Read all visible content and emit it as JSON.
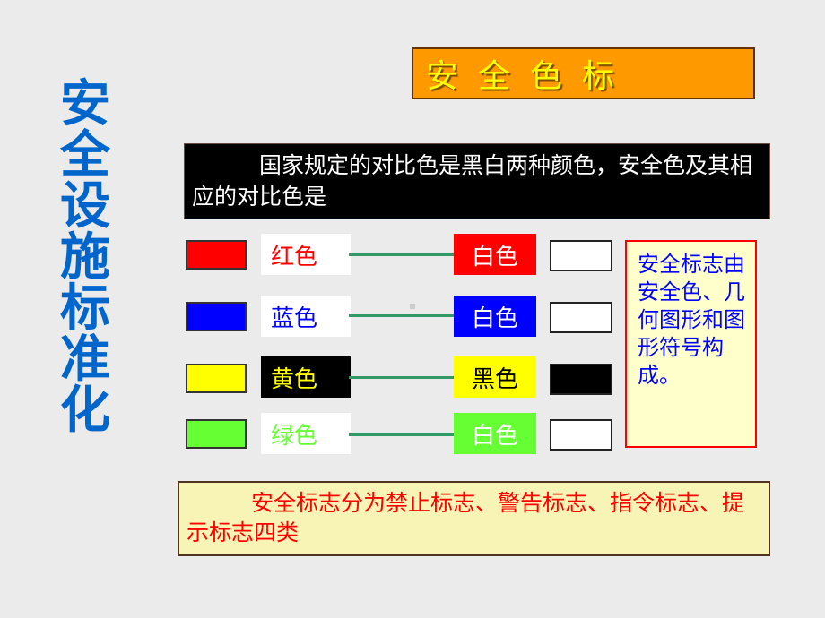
{
  "side_title": [
    "安",
    "全",
    "设",
    "施",
    "标",
    "准",
    "化"
  ],
  "title": "安全色标",
  "intro_text": "国家规定的对比色是黑白两种颜色，安全色及其相应的对比色是",
  "rows": [
    {
      "color_name": "红色",
      "swatch_color": "#ff0000",
      "label_bg": "#ffffff",
      "label_fg": "#ff0000",
      "contrast_name": "白色",
      "contrast_label_bg": "#ff0000",
      "contrast_label_fg": "#ffffff",
      "contrast_swatch_color": "#ffffff"
    },
    {
      "color_name": "蓝色",
      "swatch_color": "#0000ff",
      "label_bg": "#ffffff",
      "label_fg": "#0000ff",
      "contrast_name": "白色",
      "contrast_label_bg": "#0000ff",
      "contrast_label_fg": "#ffffff",
      "contrast_swatch_color": "#ffffff"
    },
    {
      "color_name": "黄色",
      "swatch_color": "#ffff00",
      "label_bg": "#000000",
      "label_fg": "#ffff00",
      "contrast_name": "黑色",
      "contrast_label_bg": "#ffff00",
      "contrast_label_fg": "#000000",
      "contrast_swatch_color": "#000000"
    },
    {
      "color_name": "绿色",
      "swatch_color": "#66ff33",
      "label_bg": "#ffffff",
      "label_fg": "#66ff33",
      "contrast_name": "白色",
      "contrast_label_bg": "#66ff33",
      "contrast_label_fg": "#ffffff",
      "contrast_swatch_color": "#ffffff"
    }
  ],
  "note_text": "安全标志由安全色、几何图形和图形符号构成。",
  "bottom_text": "安全标志分为禁止标志、警告标志、指令标志、提示标志四类"
}
